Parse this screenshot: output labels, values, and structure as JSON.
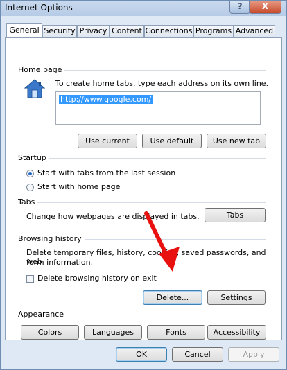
{
  "window": {
    "title": "Internet Options",
    "help_label": "?",
    "close_label": "X"
  },
  "tabs": [
    {
      "label": "General",
      "active": true
    },
    {
      "label": "Security"
    },
    {
      "label": "Privacy"
    },
    {
      "label": "Content"
    },
    {
      "label": "Connections"
    },
    {
      "label": "Programs"
    },
    {
      "label": "Advanced"
    }
  ],
  "home_page": {
    "label": "Home page",
    "description": "To create home tabs, type each address on its own line.",
    "url": "http://www.google.com/",
    "use_current": "Use current",
    "use_default": "Use default",
    "use_new_tab": "Use new tab"
  },
  "startup": {
    "label": "Startup",
    "option1": "Start with tabs from the last session",
    "option2": "Start with home page",
    "selected": 1
  },
  "tabs_group": {
    "label": "Tabs",
    "description": "Change how webpages are displayed in tabs.",
    "button": "Tabs"
  },
  "browsing_history": {
    "label": "Browsing history",
    "description_line1": "Delete temporary files, history, cookies, saved passwords, and web",
    "description_line2": "form information.",
    "checkbox_label": "Delete browsing history on exit",
    "checked": false,
    "delete_button": "Delete...",
    "settings_button": "Settings"
  },
  "appearance": {
    "label": "Appearance",
    "colors": "Colors",
    "languages": "Languages",
    "fonts": "Fonts",
    "accessibility": "Accessibility"
  },
  "footer": {
    "ok": "OK",
    "cancel": "Cancel",
    "apply": "Apply"
  },
  "colors": {
    "annotation_arrow": "#e8110f",
    "selection": "#3399ff"
  }
}
